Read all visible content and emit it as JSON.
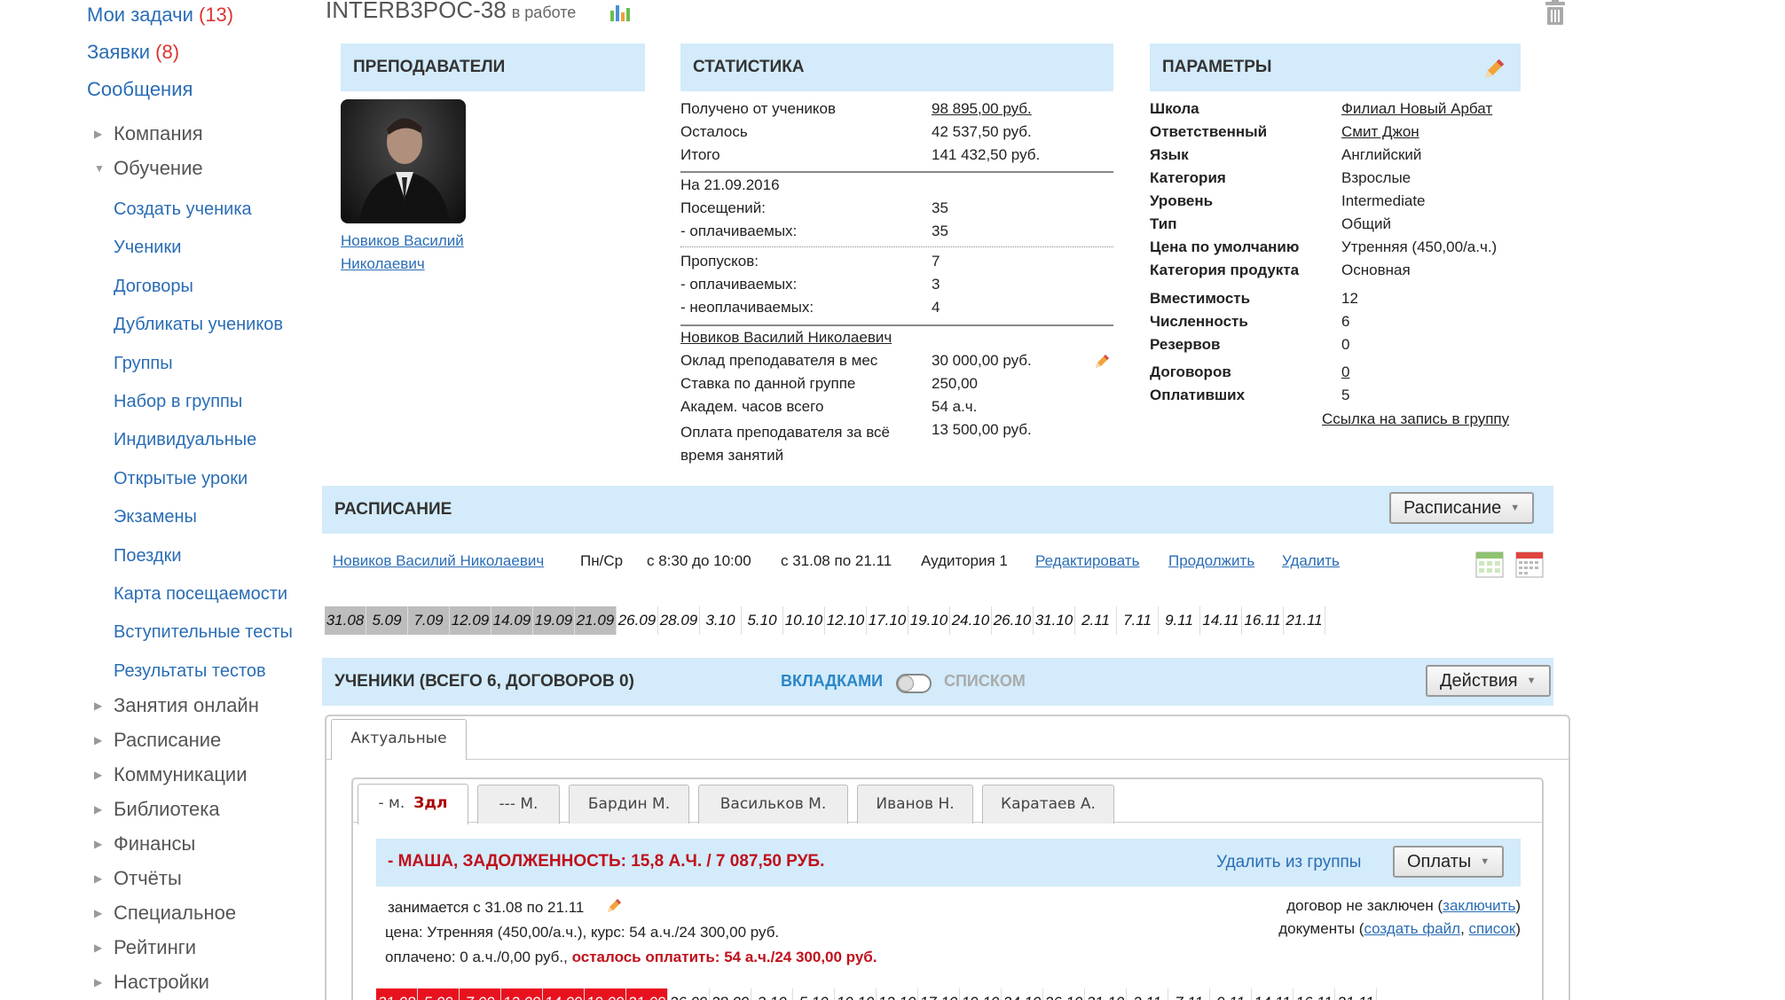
{
  "sidebar": {
    "top": [
      {
        "label": "Мои задачи",
        "count": "(13)"
      },
      {
        "label": "Заявки",
        "count": "(8)"
      },
      {
        "label": "Сообщения",
        "count": ""
      }
    ],
    "sections_before": [
      "Компания"
    ],
    "open_section": "Обучение",
    "sub_items": [
      "Создать ученика",
      "Ученики",
      "Договоры",
      "Дубликаты учеников",
      "Группы",
      "Набор в группы",
      "Индивидуальные",
      "Открытые уроки",
      "Экзамены",
      "Поездки",
      "Карта посещаемости",
      "Вступительные тесты",
      "Результаты тестов"
    ],
    "sections_after": [
      "Занятия онлайн",
      "Расписание",
      "Коммуникации",
      "Библиотека",
      "Финансы",
      "Отчёты",
      "Специальное",
      "Рейтинги",
      "Настройки"
    ]
  },
  "header": {
    "title": "INTERB3POC-38",
    "status": "в работе"
  },
  "teachers": {
    "title": "ПРЕПОДАВАТЕЛИ",
    "name_line1": "Новиков Василий",
    "name_line2": "Николаевич"
  },
  "stats": {
    "title": "СТАТИСТИКА",
    "received_label": "Получено от учеников",
    "received_value": "98 895,00 руб.",
    "remaining_label": "Осталось",
    "remaining_value": "42 537,50 руб.",
    "total_label": "Итого",
    "total_value": "141 432,50 руб.",
    "date_label": "На 21.09.2016",
    "visits_label": "Посещений:",
    "visits_value": "35",
    "paid_visits_label": "- оплачиваемых:",
    "paid_visits_value": "35",
    "absences_label": "Пропусков:",
    "absences_value": "7",
    "paid_abs_label": "- оплачиваемых:",
    "paid_abs_value": "3",
    "unpaid_abs_label": "- неоплачиваемых:",
    "unpaid_abs_value": "4",
    "teacher_link": "Новиков Василий Николаевич",
    "salary_label": "Оклад преподавателя в мес",
    "salary_value": "30 000,00 руб.",
    "rate_label": "Ставка по данной группе",
    "rate_value": "250,00",
    "hours_label": "Академ. часов всего",
    "hours_value": "54 а.ч.",
    "pay_label_1": "Оплата преподавателя за всё",
    "pay_label_2": "время занятий",
    "pay_value": "13 500,00 руб."
  },
  "params": {
    "title": "ПАРАМЕТРЫ",
    "school_label": "Школа",
    "school_value": "Филиал Новый Арбат",
    "resp_label": "Ответственный",
    "resp_value": "Смит Джон",
    "lang_label": "Язык",
    "lang_value": "Английский",
    "cat_label": "Категория",
    "cat_value": "Взрослые",
    "level_label": "Уровень",
    "level_value": "Intermediate",
    "type_label": "Тип",
    "type_value": "Общий",
    "price_label": "Цена по умолчанию",
    "price_value": "Утренняя (450,00/а.ч.)",
    "prodcat_label": "Категория продукта",
    "prodcat_value": "Основная",
    "cap_label": "Вместимость",
    "cap_value": "12",
    "size_label": "Численность",
    "size_value": "6",
    "reserve_label": "Резервов",
    "reserve_value": "0",
    "contracts_label": "Договоров",
    "contracts_value": "0",
    "paid_label": "Оплативших",
    "paid_value": "5",
    "signup_link": "Ссылка на запись в группу"
  },
  "schedule": {
    "title": "РАСПИСАНИЕ",
    "button": "Расписание",
    "teacher": "Новиков Василий Николаевич",
    "days": "Пн/Ср",
    "time": "с 8:30 до 10:00",
    "period": "с 31.08 по 21.11",
    "room": "Аудитория 1",
    "edit": "Редактировать",
    "extend": "Продолжить",
    "delete": "Удалить",
    "dates": [
      "31.08",
      "5.09",
      "7.09",
      "12.09",
      "14.09",
      "19.09",
      "21.09",
      "26.09",
      "28.09",
      "3.10",
      "5.10",
      "10.10",
      "12.10",
      "17.10",
      "19.10",
      "24.10",
      "26.10",
      "31.10",
      "2.11",
      "7.11",
      "9.11",
      "14.11",
      "16.11",
      "21.11"
    ],
    "past_count": 7
  },
  "students": {
    "title": "УЧЕНИКИ (ВСЕГО 6, ДОГОВОРОВ 0)",
    "view_tabs": "ВКЛАДКАМИ",
    "view_list": "СПИСКОМ",
    "actions": "Действия",
    "outer_tab": "Актуальные",
    "tabs": [
      {
        "prefix": "- м.",
        "name": "Здл"
      },
      {
        "prefix": "",
        "name": "--- М."
      },
      {
        "prefix": "",
        "name": "Бардин М."
      },
      {
        "prefix": "",
        "name": "Васильков М."
      },
      {
        "prefix": "",
        "name": "Иванов Н."
      },
      {
        "prefix": "",
        "name": "Каратаев А."
      }
    ],
    "card": {
      "name": "- МАША",
      "debt": ", ЗАДОЛЖЕННОСТЬ: 15,8 А.Ч. / 7 087,50 РУБ.",
      "remove": "Удалить из группы",
      "payments": "Оплаты",
      "line1": "занимается с 31.08 по 21.11",
      "line2": "цена: Утренняя (450,00/а.ч.), курс: 54 а.ч./24 300,00 руб.",
      "line3a": "оплачено: 0 а.ч./0,00 руб., ",
      "line3b": "осталось оплатить: 54 а.ч./24 300,00 руб.",
      "contract_a": "договор не заключен (",
      "contract_link": "заключить",
      "contract_b": ")",
      "docs_a": "документы (",
      "docs_link1": "создать файл",
      "docs_sep": ", ",
      "docs_link2": "список",
      "docs_b": ")"
    }
  },
  "colors": {
    "accent_blue": "#d3ebfa",
    "link": "#2a6db5",
    "debt_red": "#c0101c",
    "past_grey": "#bdbdbd",
    "missed_red": "#e8121f"
  }
}
